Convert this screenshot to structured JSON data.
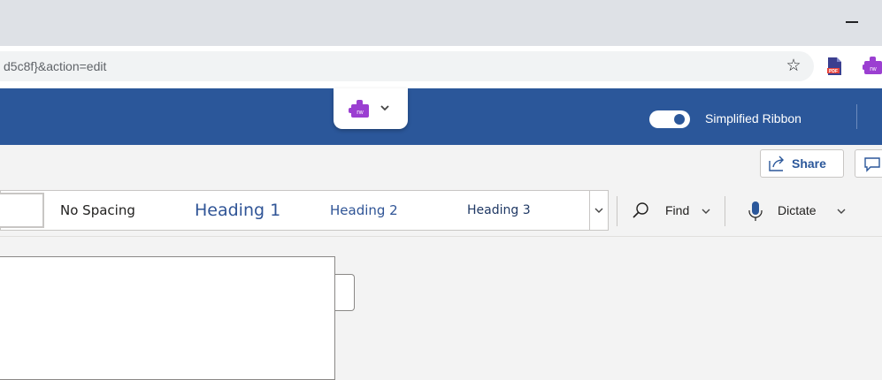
{
  "browser": {
    "url_fragment": "d5c8f}&action=edit",
    "star_glyph": "☆",
    "minimize_label": "–",
    "extensions": [
      "pdf-icon",
      "read-write-icon"
    ]
  },
  "header": {
    "toolbar_icon": "read-write-puzzle-icon",
    "simplified_ribbon_label": "Simplified Ribbon",
    "simplified_ribbon_on": true,
    "brand_color": "#2b579a"
  },
  "actions": {
    "share_label": "Share"
  },
  "ribbon": {
    "styles": [
      "No Spacing",
      "Heading 1",
      "Heading 2",
      "Heading 3"
    ],
    "find_label": "Find",
    "dictate_label": "Dictate"
  }
}
